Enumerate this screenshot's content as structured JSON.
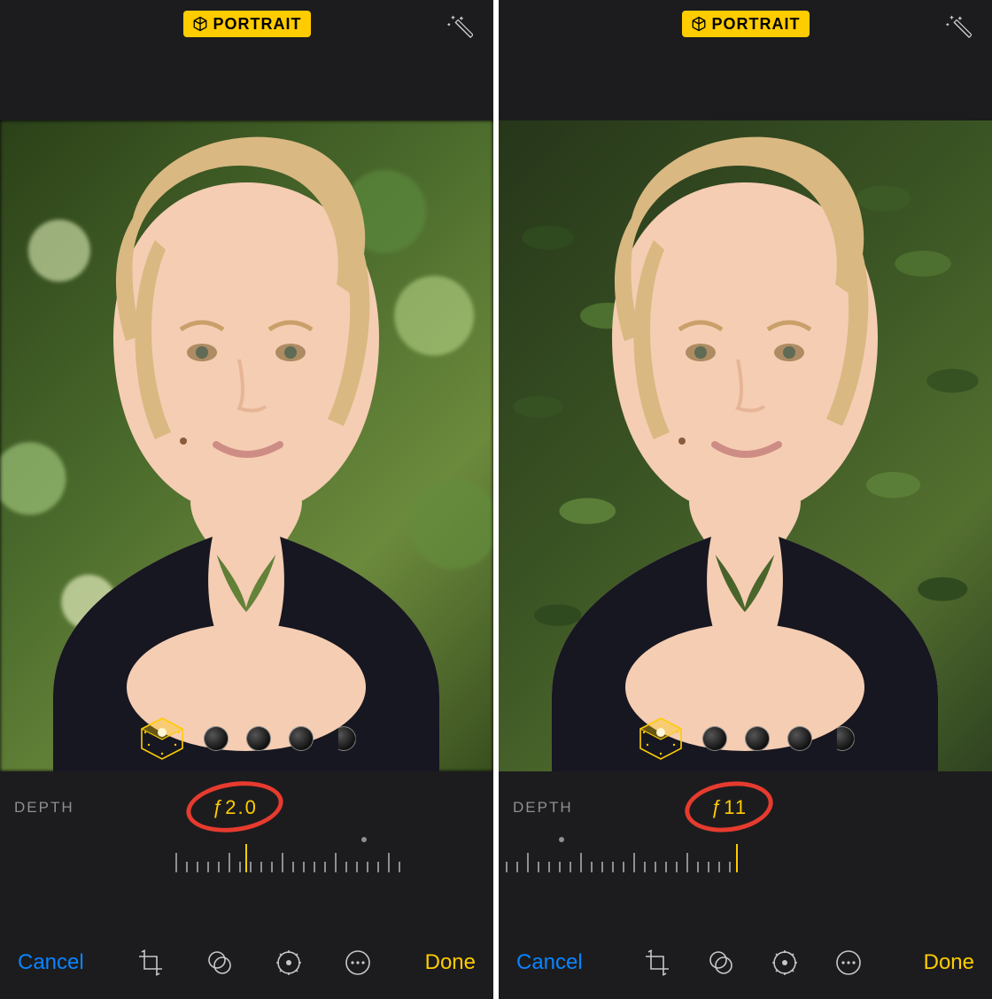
{
  "left": {
    "badge_label": "PORTRAIT",
    "depth_label": "DEPTH",
    "fstop": "ƒ2.0",
    "cancel": "Cancel",
    "done": "Done"
  },
  "right": {
    "badge_label": "PORTRAIT",
    "depth_label": "DEPTH",
    "fstop": "ƒ11",
    "cancel": "Cancel",
    "done": "Done"
  }
}
